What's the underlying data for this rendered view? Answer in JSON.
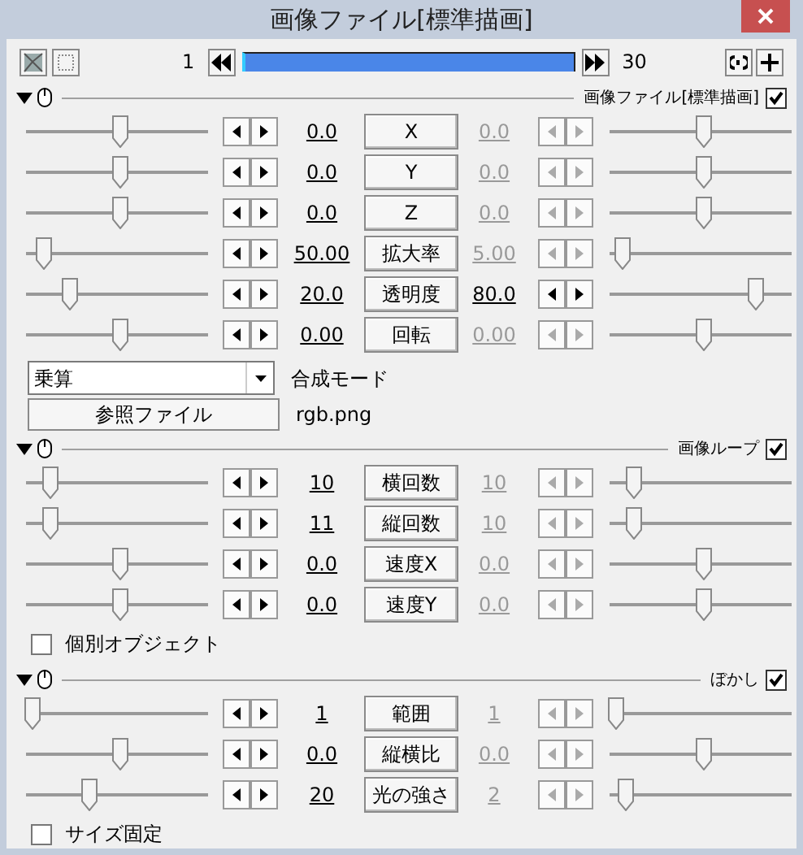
{
  "window": {
    "title": "画像ファイル[標準描画]"
  },
  "timeline": {
    "start": "1",
    "end": "30"
  },
  "sections": [
    {
      "title": "画像ファイル[標準描画]",
      "enabled": true,
      "expanded": true,
      "items": [
        {
          "kind": "track",
          "label": "X",
          "start": {
            "value": "0.0",
            "level": 0.52
          },
          "end": {
            "value": "0.0",
            "level": 0.52,
            "active": false
          }
        },
        {
          "kind": "track",
          "label": "Y",
          "start": {
            "value": "0.0",
            "level": 0.52
          },
          "end": {
            "value": "0.0",
            "level": 0.52,
            "active": false
          }
        },
        {
          "kind": "track",
          "label": "Z",
          "start": {
            "value": "0.0",
            "level": 0.52
          },
          "end": {
            "value": "0.0",
            "level": 0.52,
            "active": false
          }
        },
        {
          "kind": "track",
          "label": "拡大率",
          "start": {
            "value": "50.00",
            "level": 0.1
          },
          "end": {
            "value": "5.00",
            "level": 0.07,
            "active": false
          }
        },
        {
          "kind": "track",
          "label": "透明度",
          "start": {
            "value": "20.0",
            "level": 0.24
          },
          "end": {
            "value": "80.0",
            "level": 0.8,
            "active": true
          }
        },
        {
          "kind": "track",
          "label": "回転",
          "start": {
            "value": "0.00",
            "level": 0.52
          },
          "end": {
            "value": "0.00",
            "level": 0.52,
            "active": false
          }
        },
        {
          "kind": "select",
          "value": "乗算",
          "label": "合成モード"
        },
        {
          "kind": "file",
          "button": "参照ファイル",
          "value": "rgb.png"
        }
      ]
    },
    {
      "title": "画像ループ",
      "enabled": true,
      "expanded": true,
      "items": [
        {
          "kind": "track",
          "label": "横回数",
          "start": {
            "value": "10",
            "level": 0.13
          },
          "end": {
            "value": "10",
            "level": 0.13,
            "active": false
          }
        },
        {
          "kind": "track",
          "label": "縦回数",
          "start": {
            "value": "11",
            "level": 0.13
          },
          "end": {
            "value": "10",
            "level": 0.13,
            "active": false
          }
        },
        {
          "kind": "track",
          "label": "速度X",
          "start": {
            "value": "0.0",
            "level": 0.52
          },
          "end": {
            "value": "0.0",
            "level": 0.52,
            "active": false
          }
        },
        {
          "kind": "track",
          "label": "速度Y",
          "start": {
            "value": "0.0",
            "level": 0.52
          },
          "end": {
            "value": "0.0",
            "level": 0.52,
            "active": false
          }
        },
        {
          "kind": "checkbox",
          "label": "個別オブジェクト",
          "checked": false
        }
      ]
    },
    {
      "title": "ぼかし",
      "enabled": true,
      "expanded": true,
      "items": [
        {
          "kind": "track",
          "label": "範囲",
          "start": {
            "value": "1",
            "level": 0.04
          },
          "end": {
            "value": "1",
            "level": 0.04,
            "active": false
          }
        },
        {
          "kind": "track",
          "label": "縦横比",
          "start": {
            "value": "0.0",
            "level": 0.52
          },
          "end": {
            "value": "0.0",
            "level": 0.52,
            "active": false
          }
        },
        {
          "kind": "track",
          "label": "光の強さ",
          "start": {
            "value": "20",
            "level": 0.35
          },
          "end": {
            "value": "2",
            "level": 0.09,
            "active": false
          }
        },
        {
          "kind": "checkbox",
          "label": "サイズ固定",
          "checked": false
        }
      ]
    }
  ]
}
